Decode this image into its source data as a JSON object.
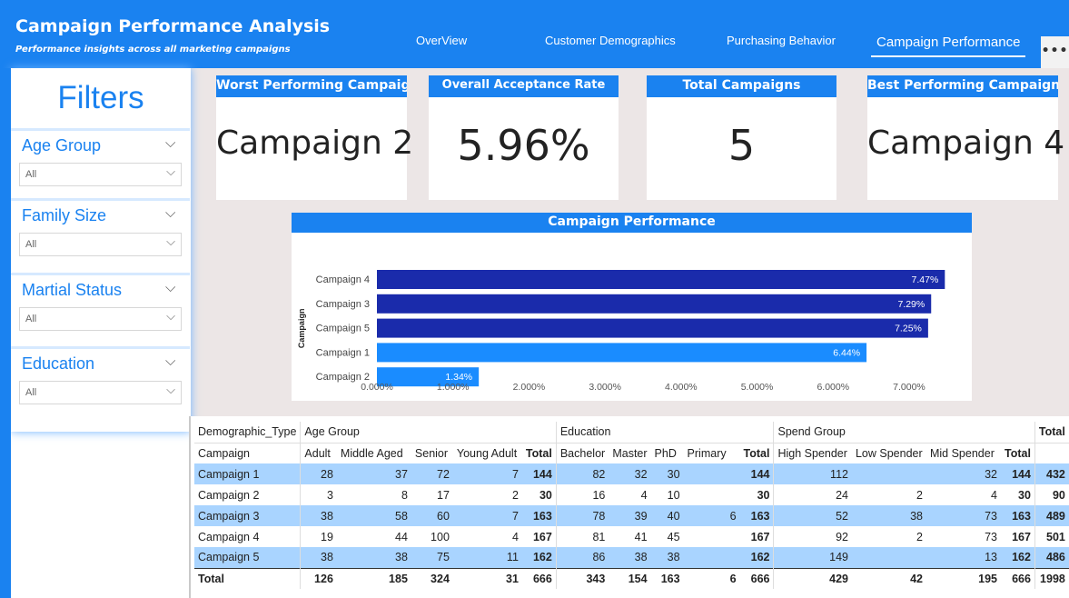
{
  "header": {
    "title": "Campaign Performance Analysis",
    "subtitle": "Performance insights across all marketing campaigns",
    "nav": [
      "OverView",
      "Customer Demographics",
      "Purchasing Behavior",
      "Campaign Performance"
    ],
    "more": "•••",
    "accent": "#1a82f0"
  },
  "sidebar": {
    "title": "Filters",
    "filters": [
      {
        "label": "Age Group",
        "value": "All"
      },
      {
        "label": "Family Size",
        "value": "All"
      },
      {
        "label": "Martial Status",
        "value": "All"
      },
      {
        "label": "Education",
        "value": "All"
      }
    ]
  },
  "kpis": [
    {
      "title": "Worst Performing Campaign",
      "value": "Campaign 2"
    },
    {
      "title": "Overall Acceptance Rate",
      "value": "5.96%"
    },
    {
      "title": "Total Campaigns",
      "value": "5"
    },
    {
      "title": "Best Performing Campaign",
      "value": "Campaign 4"
    }
  ],
  "chart_data": {
    "type": "bar",
    "orientation": "horizontal",
    "title": "Campaign Performance",
    "ylabel": "Campaign",
    "xlabel": "",
    "categories": [
      "Campaign 4",
      "Campaign 3",
      "Campaign 5",
      "Campaign 1",
      "Campaign 2"
    ],
    "values": [
      7.47,
      7.29,
      7.25,
      6.44,
      1.34
    ],
    "labels": [
      "7.47%",
      "7.29%",
      "7.25%",
      "6.44%",
      "1.34%"
    ],
    "colors": [
      "#1a2bab",
      "#1a2bab",
      "#1a2bab",
      "#1a8cff",
      "#1a8cff"
    ],
    "xticks": [
      "0.000%",
      "1.000%",
      "2.000%",
      "3.000%",
      "4.000%",
      "5.000%",
      "6.000%",
      "7.000%"
    ],
    "xlim": [
      0,
      7.55
    ]
  },
  "table": {
    "groups": [
      "Demographic_Type",
      "Age Group",
      "Education",
      "Spend Group",
      "Total"
    ],
    "columns": [
      "Campaign",
      "Adult",
      "Middle Aged",
      "Senior",
      "Young Adult",
      "Total",
      "Bachelor",
      "Master",
      "PhD",
      "Primary",
      "Total",
      "High Spender",
      "Low Spender",
      "Mid Spender",
      "Total"
    ],
    "rows": [
      [
        "Campaign 1",
        "28",
        "37",
        "72",
        "7",
        "144",
        "82",
        "32",
        "30",
        "",
        "144",
        "112",
        "",
        "32",
        "144",
        "432"
      ],
      [
        "Campaign 2",
        "3",
        "8",
        "17",
        "2",
        "30",
        "16",
        "4",
        "10",
        "",
        "30",
        "24",
        "2",
        "4",
        "30",
        "90"
      ],
      [
        "Campaign 3",
        "38",
        "58",
        "60",
        "7",
        "163",
        "78",
        "39",
        "40",
        "6",
        "163",
        "52",
        "38",
        "73",
        "163",
        "489"
      ],
      [
        "Campaign 4",
        "19",
        "44",
        "100",
        "4",
        "167",
        "81",
        "41",
        "45",
        "",
        "167",
        "92",
        "2",
        "73",
        "167",
        "501"
      ],
      [
        "Campaign 5",
        "38",
        "38",
        "75",
        "11",
        "162",
        "86",
        "38",
        "38",
        "",
        "162",
        "149",
        "",
        "13",
        "162",
        "486"
      ]
    ],
    "totals": [
      "Total",
      "126",
      "185",
      "324",
      "31",
      "666",
      "343",
      "154",
      "163",
      "6",
      "666",
      "429",
      "42",
      "195",
      "666",
      "1998"
    ]
  }
}
